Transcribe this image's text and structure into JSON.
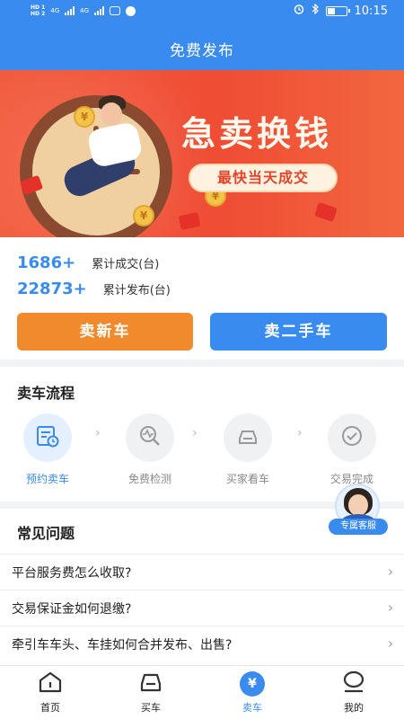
{
  "status_bar": {
    "sim1": "HD 1",
    "sim2": "HD 2",
    "net": "4G",
    "time": "10:15"
  },
  "header": {
    "title": "免费发布"
  },
  "banner": {
    "headline": "急卖换钱",
    "subtitle": "最快当天成交",
    "coin_symbol": "¥"
  },
  "stats": [
    {
      "value": "1686+",
      "label": "累计成交(台)"
    },
    {
      "value": "22873+",
      "label": "累计发布(台)"
    }
  ],
  "actions": {
    "sell_new": "卖新车",
    "sell_used": "卖二手车"
  },
  "process": {
    "title": "卖车流程",
    "steps": [
      {
        "label": "预约卖车",
        "icon": "calendar-clock-icon",
        "active": true
      },
      {
        "label": "免费检测",
        "icon": "inspection-icon",
        "active": false
      },
      {
        "label": "买家看车",
        "icon": "car-icon",
        "active": false
      },
      {
        "label": "交易完成",
        "icon": "check-circle-icon",
        "active": false
      }
    ]
  },
  "service": {
    "label": "专属客服"
  },
  "faq": {
    "title": "常见问题",
    "items": [
      "平台服务费怎么收取?",
      "交易保证金如何退缴?",
      "牵引车车头、车挂如何合并发布、出售?"
    ]
  },
  "tabs": [
    {
      "label": "首页",
      "icon": "home-icon",
      "active": false
    },
    {
      "label": "买车",
      "icon": "car-icon",
      "active": false
    },
    {
      "label": "卖车",
      "icon": "yen-icon",
      "symbol": "¥",
      "active": true
    },
    {
      "label": "我的",
      "icon": "profile-icon",
      "active": false
    }
  ],
  "colors": {
    "primary": "#3a8bf0",
    "orange": "#f08a2c",
    "banner_red": "#ef4d34"
  }
}
